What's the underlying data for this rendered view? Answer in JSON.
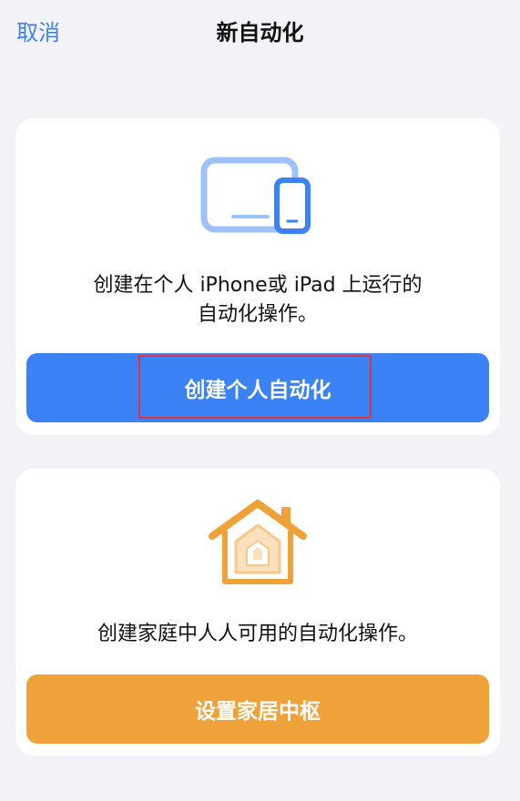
{
  "nav": {
    "cancel_label": "取消",
    "title": "新自动化"
  },
  "personal": {
    "icon": "ipad-iphone-icon",
    "description_line1": "创建在个人 iPhone或 iPad 上运行的",
    "description_line2": "自动化操作。",
    "button_label": "创建个人自动化",
    "accent_color": "#3a82f6"
  },
  "home": {
    "icon": "home-icon",
    "description": "创建家庭中人人可用的自动化操作。",
    "button_label": "设置家居中枢",
    "accent_color": "#f0a23a"
  },
  "highlight_color": "#e5303d"
}
